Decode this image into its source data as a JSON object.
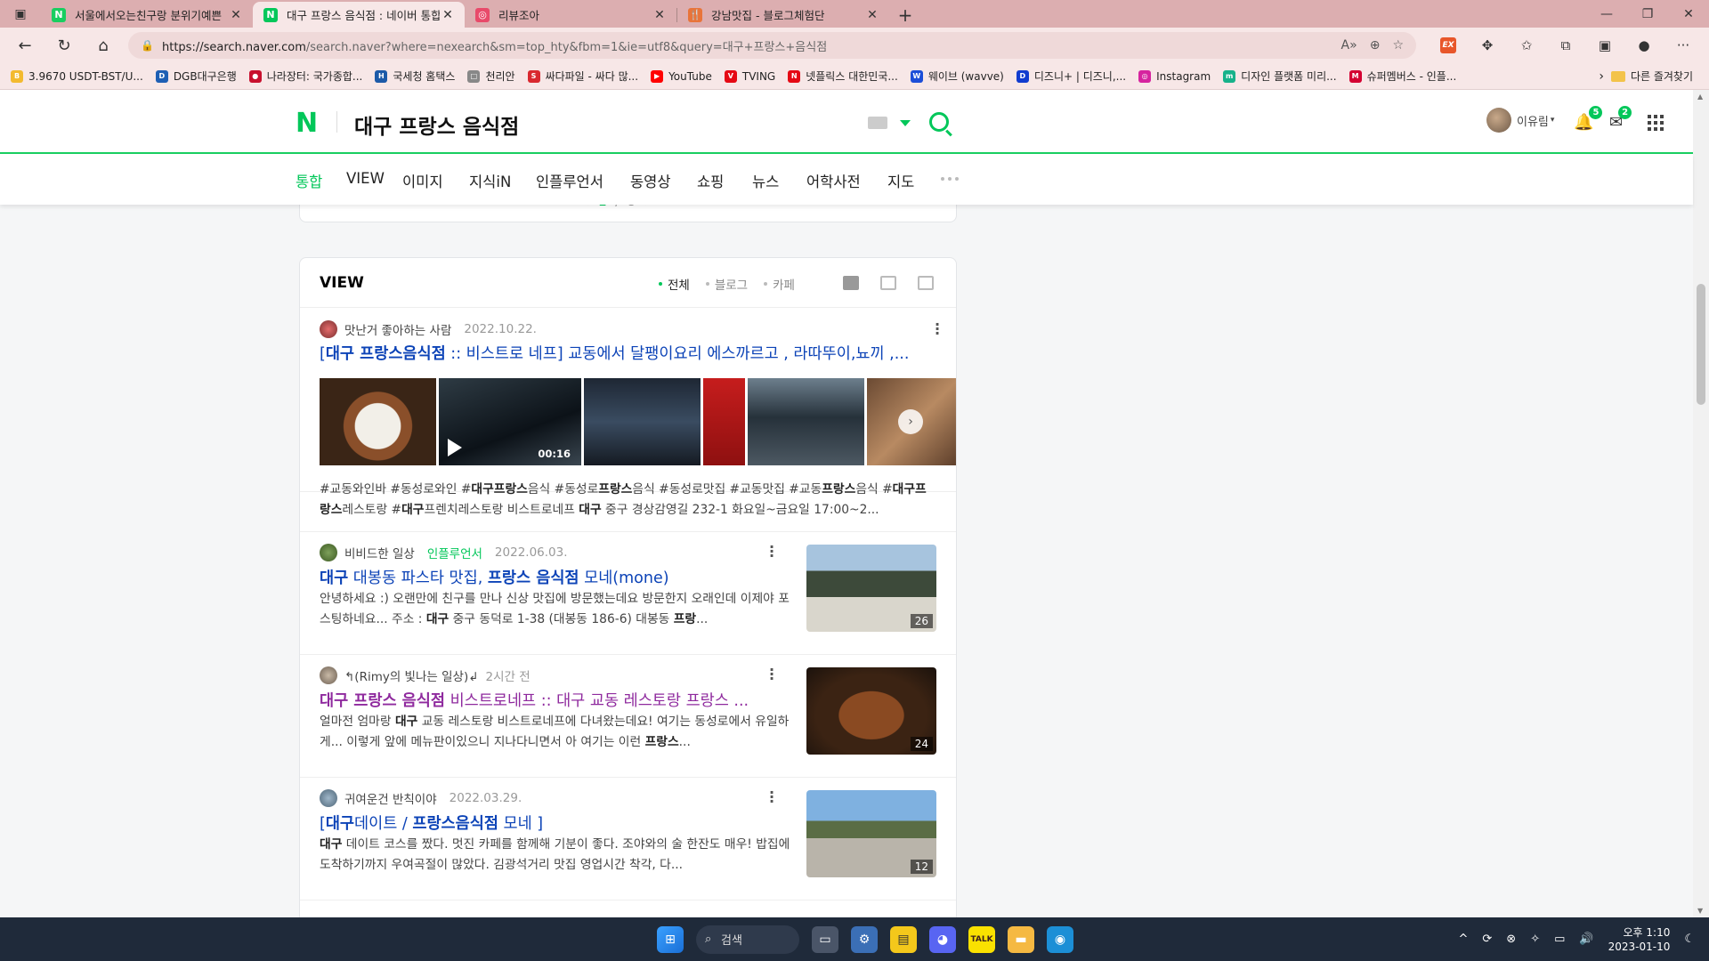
{
  "browser": {
    "tabs": [
      {
        "title": "서울에서오는친구랑 분위기예쁜",
        "icon_color": "#19ce60",
        "icon_text": "N",
        "active": false
      },
      {
        "title": "대구 프랑스 음식점 : 네이버 통합",
        "icon_color": "#03c75a",
        "icon_text": "N",
        "active": true
      },
      {
        "title": "리뷰조아",
        "icon_color": "#e84a6a",
        "icon_text": "◎",
        "active": false
      },
      {
        "title": "강남맛집 - 블로그체험단",
        "icon_color": "#e8743a",
        "icon_text": "🍴",
        "active": false
      }
    ],
    "url_host": "https://search.naver.com",
    "url_path": "/search.naver?where=nexearch&sm=top_hty&fbm=1&ie=utf8&query=대구+프랑스+음식점",
    "bookmarks": [
      {
        "label": "3.9670 USDT-BST/U...",
        "color": "#f3ba2f",
        "text": "B"
      },
      {
        "label": "DGB대구은행",
        "color": "#1e5fb4",
        "text": "D"
      },
      {
        "label": "나라장터: 국가종합...",
        "color": "#c8102e",
        "text": "●"
      },
      {
        "label": "국세청 홈택스",
        "color": "#1c5aa8",
        "text": "H"
      },
      {
        "label": "천리안",
        "color": "#888888",
        "text": "□"
      },
      {
        "label": "싸다파일 - 싸다 많...",
        "color": "#d9282f",
        "text": "S"
      },
      {
        "label": "YouTube",
        "color": "#ff0000",
        "text": "▶"
      },
      {
        "label": "TVING",
        "color": "#e50914",
        "text": "V"
      },
      {
        "label": "넷플릭스 대한민국...",
        "color": "#e50914",
        "text": "N"
      },
      {
        "label": "웨이브 (wavve)",
        "color": "#1c4ed8",
        "text": "W"
      },
      {
        "label": "디즈니+ | 디즈니,...",
        "color": "#113ccf",
        "text": "D"
      },
      {
        "label": "Instagram",
        "color": "#d6249f",
        "text": "◎"
      },
      {
        "label": "디자인 플랫폼 미리...",
        "color": "#16b28a",
        "text": "m"
      },
      {
        "label": "슈퍼멤버스 - 인플...",
        "color": "#d40032",
        "text": "M"
      }
    ],
    "other_bookmarks": "다른 즐겨찾기"
  },
  "naver": {
    "logo": "N",
    "query": "대구 프랑스 음식점",
    "user_name": "이유림",
    "notif_count": "5",
    "mail_count": "2",
    "tabs": [
      "통합",
      "VIEW",
      "이미지",
      "지식iN",
      "인플루언서",
      "동영상",
      "쇼핑",
      "뉴스",
      "어학사전",
      "지도"
    ],
    "pager": {
      "current": "1",
      "sep": "/",
      "total": "3"
    }
  },
  "view": {
    "title": "VIEW",
    "filters": [
      "전체",
      "블로그",
      "카페"
    ],
    "posts": [
      {
        "author": "맛난거 좋아하는 사람",
        "date": "2022.10.22.",
        "title_html": "[<b>대구 프랑스음식점</b> :: 비스트로 네프] 교동에서 달팽이요리 에스까르고 , 라따뚜이,뇨끼 ,...",
        "desc_html": "#교동와인바 #동성로와인 #<b>대구프랑스</b>음식 #동성로<b>프랑스</b>음식 #동성로맛집 #교동맛집 #교동<b>프랑스</b>음식 #<b>대구프랑스</b>레스토랑 #<b>대구</b>프렌치레스토랑 비스트로네프 <b>대구</b> 중구 경상감영길 232-1 화요일~금요일 17:00~2...",
        "video_duration": "00:16"
      },
      {
        "author": "비비드한 일상",
        "badge": "인플루언서",
        "date": "2022.06.03.",
        "title_html": "<b>대구</b> 대봉동 파스타 맛집, <b>프랑스 음식점</b> 모네(mone)",
        "desc_html": "안녕하세요 :) 오랜만에 친구를 만나 신상 맛집에 방문했는데요 방문한지 오래인데 이제야 포스팅하네요... 주소 : <b>대구</b> 중구 동덕로 1-38 (대봉동 186-6) 대봉동 <b>프랑</b>...",
        "photo_count": "26"
      },
      {
        "author": "↰(Rimy의 빛나는 일상)↲",
        "date": "2시간 전",
        "title_html": "<b>대구 프랑스 음식점</b> 비스트로네프 :: 대구 교동 레스토랑 프랑스 ...",
        "desc_html": "얼마전 엄마랑 <b>대구</b> 교동 레스토랑 비스트로네프에 다녀왔는데요! 여기는 동성로에서 유일하게... 이렇게 앞에 메뉴판이있으니 지나다니면서 아 여기는 이런 <b>프랑스</b>...",
        "photo_count": "24"
      },
      {
        "author": "귀여운건 반칙이야",
        "date": "2022.03.29.",
        "title_html": "[<b>대구</b>데이트 / <b>프랑스음식점</b> 모네 ]",
        "desc_html": "<b>대구</b> 데이트 코스를 짰다. 멋진 카페를 함께해 기분이 좋다. 조야와의 술 한잔도 매우! 밥집에 도착하기까지 우여곡절이 많았다. 김광석거리 맛집 영업시간 착각, 다...",
        "photo_count": "12"
      }
    ]
  },
  "taskbar": {
    "search_label": "검색",
    "time": "오후 1:10",
    "date": "2023-01-10"
  }
}
